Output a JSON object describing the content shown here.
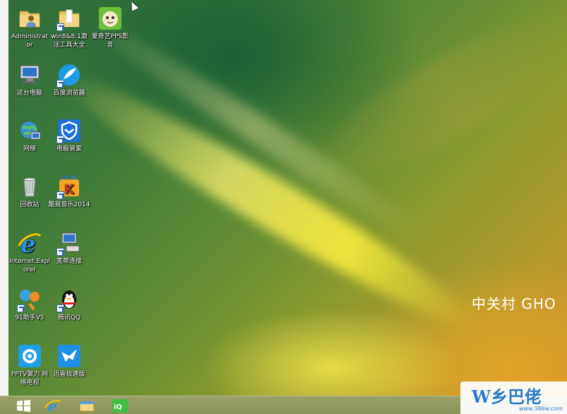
{
  "desktop_icons": [
    {
      "name": "icon-administrator",
      "label": "Administrat or",
      "icon": "folder-user-icon"
    },
    {
      "name": "icon-win8-tools",
      "label": "win8&8.1激活工具大全",
      "icon": "folder-icon"
    },
    {
      "name": "icon-iqiyi-pps",
      "label": "爱奇艺PPS影音",
      "icon": "pps-player-icon"
    },
    {
      "name": "icon-this-pc",
      "label": "这台电脑",
      "icon": "computer-icon"
    },
    {
      "name": "icon-baidu-browser",
      "label": "百度浏览器",
      "icon": "baidu-browser-icon"
    },
    {
      "name": "icon-network",
      "label": "网络",
      "icon": "network-globe-icon"
    },
    {
      "name": "icon-pc-manager",
      "label": "电脑管家",
      "icon": "shield-icon"
    },
    {
      "name": "icon-recycle-bin",
      "label": "回收站",
      "icon": "recycle-bin-icon"
    },
    {
      "name": "icon-kuwo-music",
      "label": "酷我音乐2014",
      "icon": "kuwo-music-icon"
    },
    {
      "name": "icon-internet-explorer",
      "label": "Internet Explorer",
      "icon": "ie-icon"
    },
    {
      "name": "icon-broadband",
      "label": "宽带连接",
      "icon": "broadband-connection-icon"
    },
    {
      "name": "icon-91-assistant",
      "label": "91助手V5",
      "icon": "91-assistant-icon"
    },
    {
      "name": "icon-tencent-qq",
      "label": "腾讯QQ",
      "icon": "qq-penguin-icon"
    },
    {
      "name": "icon-pptv",
      "label": "PPTV聚力 网络电视",
      "icon": "pptv-icon"
    },
    {
      "name": "icon-xunlei",
      "label": "迅雷极速版",
      "icon": "xunlei-bird-icon"
    }
  ],
  "watermark": {
    "text": "中关村 GHO"
  },
  "site_badge": {
    "brand": "W乡巴佬",
    "url": "www.386w.com"
  },
  "taskbar": {
    "items": [
      {
        "name": "start-button",
        "icon": "windows-logo-icon"
      },
      {
        "name": "taskbar-ie",
        "icon": "ie-icon"
      },
      {
        "name": "taskbar-file-explorer",
        "icon": "file-explorer-icon"
      },
      {
        "name": "taskbar-iqiyi",
        "icon": "iqiyi-icon"
      }
    ]
  },
  "colors": {
    "accent_blue": "#2a7bc8",
    "taskbar": "#8b9258"
  }
}
